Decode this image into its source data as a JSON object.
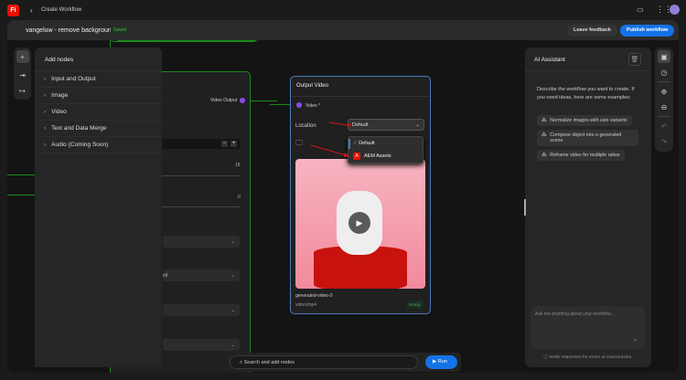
{
  "topbar": {
    "logo": "Fi",
    "back_label": "Create Workflow"
  },
  "header": {
    "workflow_name": "vangeluw - remove background",
    "status": "Saved",
    "leave_feedback": "Leave feedback",
    "publish": "Publish workflow"
  },
  "add_nodes": {
    "title": "Add nodes",
    "items": [
      {
        "label": "Input and Output"
      },
      {
        "label": "Image"
      },
      {
        "label": "Video"
      },
      {
        "label": "Text and Data Merge"
      },
      {
        "label": "Audio (Coming Soon)"
      }
    ]
  },
  "bg_node": {
    "port_label": "Video Output",
    "value_1": "18",
    "value_2": "0",
    "select_partial": "eft"
  },
  "output_node": {
    "title": "Output Video",
    "port_label": "Video *",
    "location_label": "Location",
    "location_value": "Default",
    "options": [
      {
        "label": "Default",
        "selected": true
      },
      {
        "label": "AEM Assets",
        "selected": false
      }
    ],
    "file_name": "generated-video-0",
    "file_type": "video/mp4",
    "file_status": "Ready"
  },
  "ai": {
    "title": "AI Assistant",
    "intro": "Describe the workflow you want to create. If you need ideas, here are some examples:",
    "suggestions": [
      "Normalize images with size variants",
      "Compose object into a generated scene",
      "Reframe video for multiple ratios"
    ],
    "placeholder": "Ask me anything about your workflow...",
    "disclaimer": "Verify responses for errors or inaccuracies."
  },
  "bottom": {
    "search_placeholder": "Search and add nodes",
    "run": "Run"
  },
  "colors": {
    "accent": "#1473e6",
    "wire": "#1a8a1a",
    "port": "#8a4be8"
  }
}
